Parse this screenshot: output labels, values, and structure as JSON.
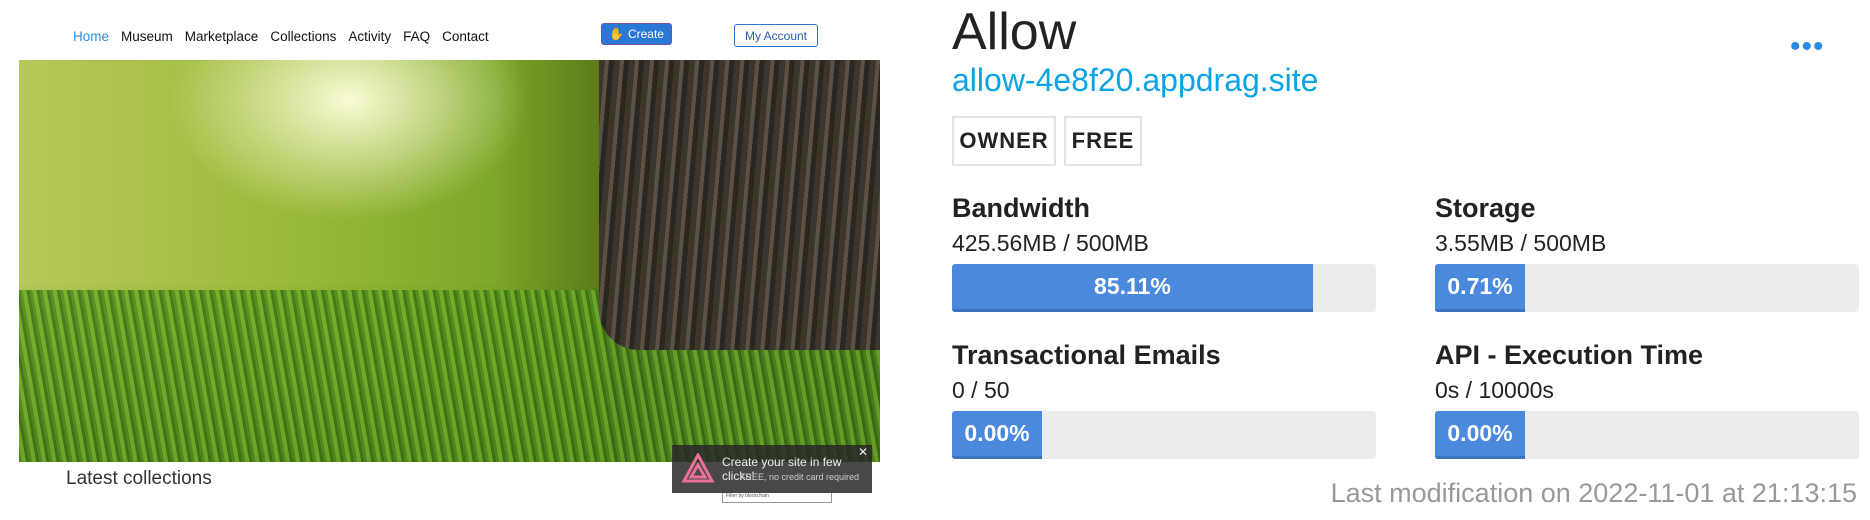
{
  "nav": {
    "items": [
      "Home",
      "Museum",
      "Marketplace",
      "Collections",
      "Activity",
      "FAQ",
      "Contact"
    ],
    "active": "Home",
    "create": "Create",
    "account": "My Account"
  },
  "hero": {
    "latest": "Latest collections"
  },
  "popup": {
    "title": "Create your site in few clicks!",
    "subtitle": "FREE, no credit card required",
    "filter": "Filter by blockchain"
  },
  "site": {
    "title": "Allow",
    "url": "allow-4e8f20.appdrag.site",
    "badges": [
      "OWNER",
      "FREE"
    ],
    "menu_icon": "more-dots-icon"
  },
  "metrics": [
    {
      "label": "Bandwidth",
      "value": "425.56MB / 500MB",
      "percent_text": "85.11%",
      "percent": 85.11
    },
    {
      "label": "Storage",
      "value": "3.55MB / 500MB",
      "percent_text": "0.71%",
      "percent": 0.71
    },
    {
      "label": "Transactional Emails",
      "value": "0 / 50",
      "percent_text": "0.00%",
      "percent": 0
    },
    {
      "label": "API - Execution Time",
      "value": "0s / 10000s",
      "percent_text": "0.00%",
      "percent": 0
    }
  ],
  "modified": "Last modification on 2022-11-01 at 21:13:15",
  "colors": {
    "accent": "#4a89dc",
    "link": "#0aa3e8"
  }
}
